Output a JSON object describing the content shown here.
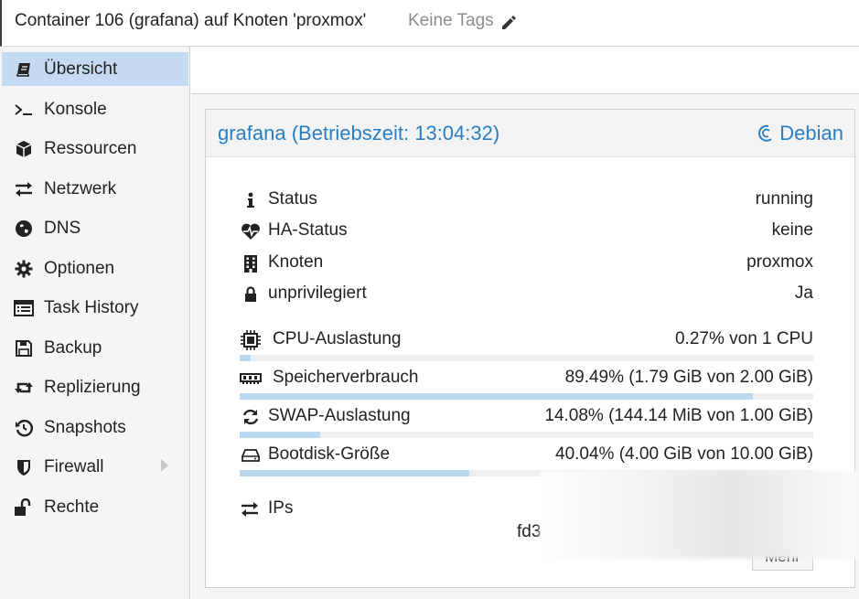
{
  "header": {
    "title": "Container 106 (grafana) auf Knoten 'proxmox'",
    "tags_label": "Keine Tags"
  },
  "sidebar": {
    "items": [
      {
        "label": "Übersicht",
        "icon": "book-icon",
        "active": true
      },
      {
        "label": "Konsole",
        "icon": "terminal-icon"
      },
      {
        "label": "Ressourcen",
        "icon": "cube-icon"
      },
      {
        "label": "Netzwerk",
        "icon": "exchange-icon"
      },
      {
        "label": "DNS",
        "icon": "globe-icon"
      },
      {
        "label": "Optionen",
        "icon": "gear-icon"
      },
      {
        "label": "Task History",
        "icon": "list-icon"
      },
      {
        "label": "Backup",
        "icon": "floppy-icon"
      },
      {
        "label": "Replizierung",
        "icon": "retweet-icon"
      },
      {
        "label": "Snapshots",
        "icon": "history-icon"
      },
      {
        "label": "Firewall",
        "icon": "shield-icon",
        "has_submenu": true
      },
      {
        "label": "Rechte",
        "icon": "unlock-icon"
      }
    ]
  },
  "panel": {
    "title": "grafana (Betriebszeit: 13:04:32)",
    "os_label": "Debian",
    "status": {
      "label": "Status",
      "value": "running"
    },
    "ha_status": {
      "label": "HA-Status",
      "value": "keine"
    },
    "node": {
      "label": "Knoten",
      "value": "proxmox"
    },
    "unprivileged": {
      "label": "unprivilegiert",
      "value": "Ja"
    },
    "cpu": {
      "label": "CPU-Auslastung",
      "value": "0.27% von 1 CPU",
      "fraction": 0.0027
    },
    "memory": {
      "label": "Speicherverbrauch",
      "value": "89.49% (1.79 GiB von 2.00 GiB)",
      "fraction": 0.8949
    },
    "swap": {
      "label": "SWAP-Auslastung",
      "value": "14.08% (144.14 MiB von 1.00 GiB)",
      "fraction": 0.1408
    },
    "bootdisk": {
      "label": "Bootdisk-Größe",
      "value": "40.04% (4.00 GiB von 10.00 GiB)",
      "fraction": 0.4004
    },
    "ips_label": "IPs",
    "ip_value_partial": "fd3",
    "more_button": "Mehr"
  },
  "colors": {
    "accent": "#2a7fc4",
    "selected": "#c3daf0",
    "bar_fill": "#bcd8ef"
  }
}
